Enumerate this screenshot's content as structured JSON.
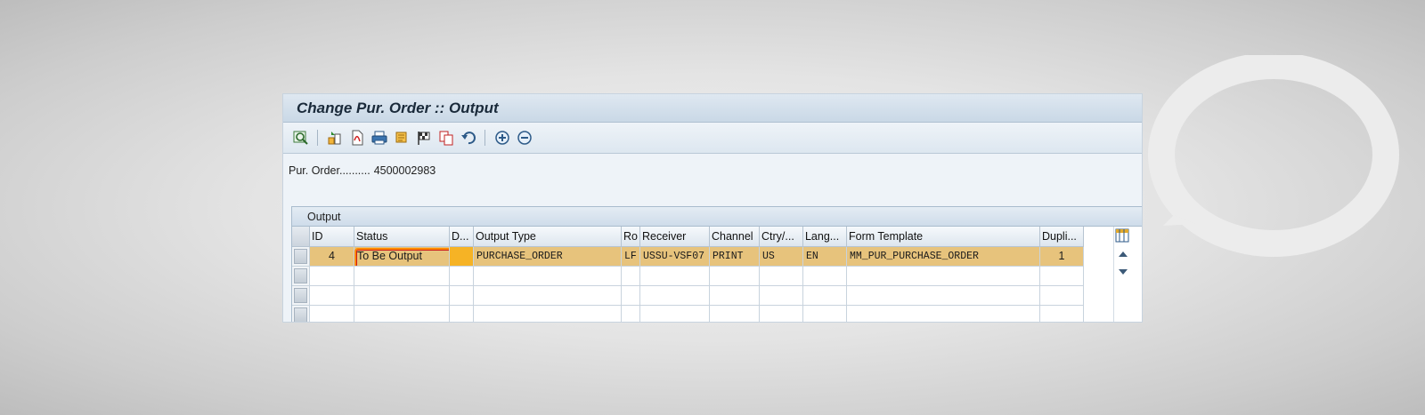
{
  "window": {
    "title": "Change Pur. Order :: Output"
  },
  "toolbar": {
    "icons": [
      "display-icon",
      "process-icon",
      "pdf-icon",
      "print-icon",
      "scroll-icon",
      "flag-icon",
      "copy-icon",
      "undo-icon",
      "add-icon",
      "remove-icon"
    ]
  },
  "header": {
    "po_label": "Pur. Order..........",
    "po_number": "4500002983"
  },
  "output_panel": {
    "title": "Output",
    "columns": [
      "ID",
      "Status",
      "D...",
      "Output Type",
      "Ro",
      "Receiver",
      "Channel",
      "Ctry/...",
      "Lang...",
      "Form Template",
      "Dupli..."
    ],
    "rows": [
      {
        "id": "4",
        "status": "To Be Output",
        "d": "",
        "output_type": "PURCHASE_ORDER",
        "ro": "LF",
        "receiver": "USSU-VSF07",
        "channel": "PRINT",
        "ctry": "US",
        "lang": "EN",
        "form_template": "MM_PUR_PURCHASE_ORDER",
        "dupli": "1"
      }
    ]
  },
  "colors": {
    "row_highlight": "#e7c37c",
    "status_ring": "#ff8a00",
    "accent_orange": "#f6b325"
  }
}
